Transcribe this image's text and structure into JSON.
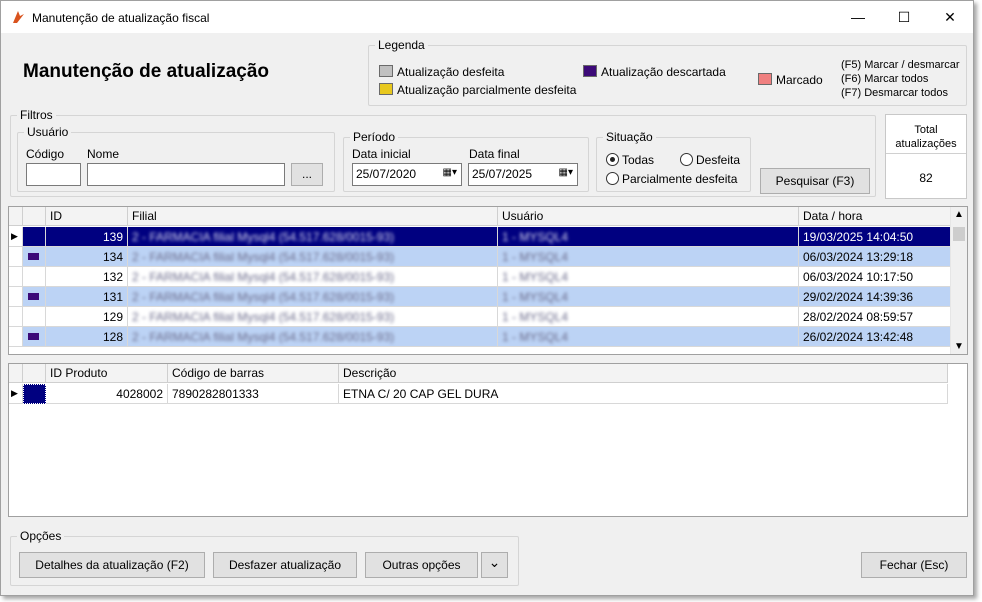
{
  "window": {
    "title": "Manutenção de atualização fiscal",
    "minimize": "—",
    "maximize": "☐",
    "close": "✕"
  },
  "page_title": "Manutenção de atualização",
  "legend": {
    "title": "Legenda",
    "items": [
      {
        "label": "Atualização desfeita",
        "color": "#c0c0c0"
      },
      {
        "label": "Atualização parcialmente desfeita",
        "color": "#e8c81e"
      },
      {
        "label": "Atualização descartada",
        "color": "#3c0a78"
      },
      {
        "label": "Marcado",
        "color": "#f08080"
      }
    ],
    "shortcuts": [
      "(F5) Marcar / desmarcar",
      "(F6) Marcar todos",
      "(F7) Desmarcar todos"
    ]
  },
  "filters": {
    "title": "Filtros",
    "usuario": {
      "title": "Usuário",
      "codigo_label": "Código",
      "nome_label": "Nome",
      "codigo_value": "",
      "nome_value": "",
      "browse": "..."
    },
    "periodo": {
      "title": "Período",
      "inicial_label": "Data inicial",
      "final_label": "Data final",
      "inicial_value": "25/07/2020",
      "final_value": "25/07/2025"
    },
    "situacao": {
      "title": "Situação",
      "options": [
        "Todas",
        "Desfeita",
        "Parcialmente desfeita"
      ],
      "selected": "Todas"
    },
    "search_button": "Pesquisar (F3)"
  },
  "total": {
    "label": "Total atualizações",
    "value": "82"
  },
  "updates_table": {
    "columns": [
      "ID",
      "Filial",
      "Usuário",
      "Data / hora"
    ],
    "rows": [
      {
        "id": "139",
        "filial": "2 - FARMACIA filial Mysql4 (54.517.628/0015-93)",
        "usuario": "1 - MYSQL4",
        "data": "19/03/2025 14:04:50"
      },
      {
        "id": "134",
        "filial": "2 - FARMACIA filial Mysql4 (54.517.628/0015-93)",
        "usuario": "1 - MYSQL4",
        "data": "06/03/2024 13:29:18"
      },
      {
        "id": "132",
        "filial": "2 - FARMACIA filial Mysql4 (54.517.628/0015-93)",
        "usuario": "1 - MYSQL4",
        "data": "06/03/2024 10:17:50"
      },
      {
        "id": "131",
        "filial": "2 - FARMACIA filial Mysql4 (54.517.628/0015-93)",
        "usuario": "1 - MYSQL4",
        "data": "29/02/2024 14:39:36"
      },
      {
        "id": "129",
        "filial": "2 - FARMACIA filial Mysql4 (54.517.628/0015-93)",
        "usuario": "1 - MYSQL4",
        "data": "28/02/2024 08:59:57"
      },
      {
        "id": "128",
        "filial": "2 - FARMACIA filial Mysql4 (54.517.628/0015-93)",
        "usuario": "1 - MYSQL4",
        "data": "26/02/2024 13:42:48"
      }
    ]
  },
  "products_table": {
    "columns": [
      "ID Produto",
      "Código de barras",
      "Descrição"
    ],
    "rows": [
      {
        "id": "4028002",
        "barcode": "7890282801333",
        "descricao": "ETNA C/ 20 CAP GEL DURA"
      }
    ]
  },
  "options": {
    "title": "Opções",
    "details_button": "Detalhes da atualização (F2)",
    "undo_button": "Desfazer atualização",
    "other_button": "Outras opções",
    "dropdown": "⌄"
  },
  "close_button": "Fechar (Esc)"
}
